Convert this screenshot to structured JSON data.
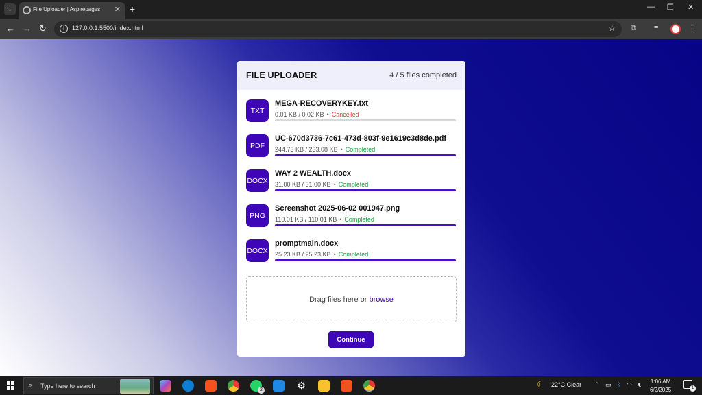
{
  "browser": {
    "tab_title": "File Uploader | Aspirepages",
    "url": "127.0.0.1:5500/index.html"
  },
  "uploader": {
    "title": "FILE UPLOADER",
    "status": "4 / 5 files completed",
    "files": [
      {
        "type": "TXT",
        "name": "MEGA-RECOVERYKEY.txt",
        "size": "0.01 KB / 0.02 KB",
        "status": "Cancelled",
        "status_kind": "cancelled",
        "progress": 0
      },
      {
        "type": "PDF",
        "name": "UC-670d3736-7c61-473d-803f-9e1619c3d8de.pdf",
        "size": "244.73 KB / 233.08 KB",
        "status": "Completed",
        "status_kind": "completed",
        "progress": 1
      },
      {
        "type": "DOCX",
        "name": "WAY 2 WEALTH.docx",
        "size": "31.00 KB / 31.00 KB",
        "status": "Completed",
        "status_kind": "completed",
        "progress": 1
      },
      {
        "type": "PNG",
        "name": "Screenshot 2025-06-02 001947.png",
        "size": "110.01 KB / 110.01 KB",
        "status": "Completed",
        "status_kind": "completed",
        "progress": 1
      },
      {
        "type": "DOCX",
        "name": "promptmain.docx",
        "size": "25.23 KB / 25.23 KB",
        "status": "Completed",
        "status_kind": "completed",
        "progress": 1
      }
    ],
    "dropzone_text": "Drag files here or",
    "browse_label": "browse",
    "continue_label": "Continue"
  },
  "colors": {
    "accent": "#3f06b8",
    "completed": "#1ea344",
    "cancelled": "#e53935"
  },
  "taskbar": {
    "search_placeholder": "Type here to search",
    "whatsapp_badge": "2",
    "weather": "22°C  Clear",
    "time": "1:06 AM",
    "date": "6/2/2025",
    "notification_count": "1"
  }
}
